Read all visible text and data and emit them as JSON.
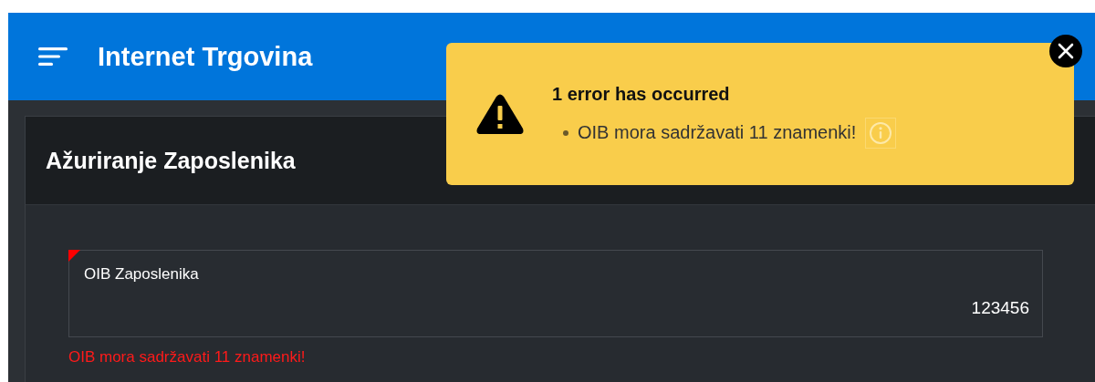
{
  "header": {
    "title": "Internet Trgovina"
  },
  "card": {
    "title": "Ažuriranje Zaposlenika"
  },
  "field": {
    "label": "OIB Zaposlenika",
    "value": "123456",
    "invalid": true,
    "message": "OIB mora sadržavati 11 znamenki!"
  },
  "toast": {
    "title": "1 error has occurred",
    "messages": [
      {
        "text": "OIB mora sadržavati 11 znamenki!"
      }
    ]
  }
}
